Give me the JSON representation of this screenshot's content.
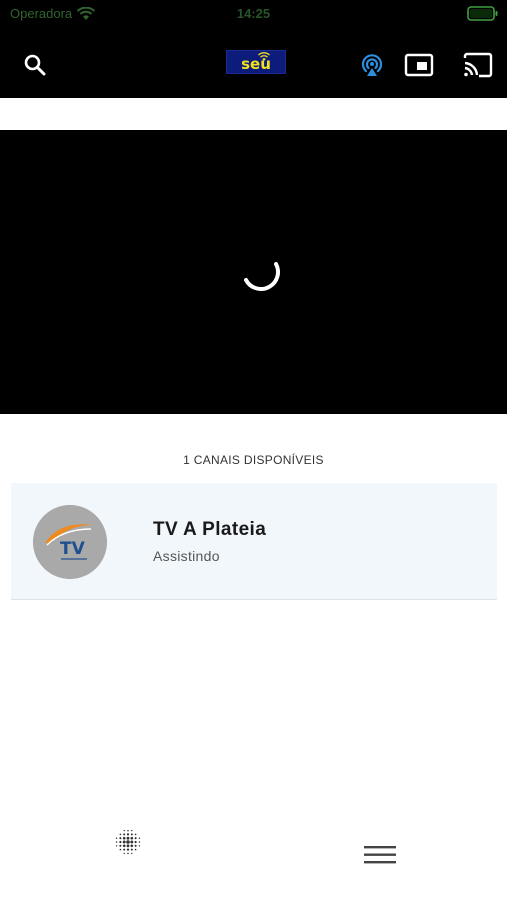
{
  "status_bar": {
    "carrier": "Operadora",
    "time": "14:25"
  },
  "app_bar": {
    "logo_text": "seu",
    "icons": {
      "search": "search-icon",
      "airplay": "airplay-icon",
      "pip": "picture-in-picture-icon",
      "cast": "cast-icon"
    }
  },
  "player": {
    "state": "loading"
  },
  "channels": {
    "count_label": "1 CANAIS DISPONÍVEIS",
    "items": [
      {
        "name": "TV A Plateia",
        "status": "Assistindo",
        "logo_text": "TV"
      }
    ]
  },
  "bottom_nav": {
    "icons": {
      "dots": "dot-grid-icon",
      "menu": "hamburger-menu-icon"
    }
  },
  "colors": {
    "header_bg": "#000000",
    "accent_blue": "#2b8fe0",
    "logo_bg": "#0d1b7a",
    "logo_text": "#f2e21a",
    "card_bg": "#f2f7fc"
  }
}
